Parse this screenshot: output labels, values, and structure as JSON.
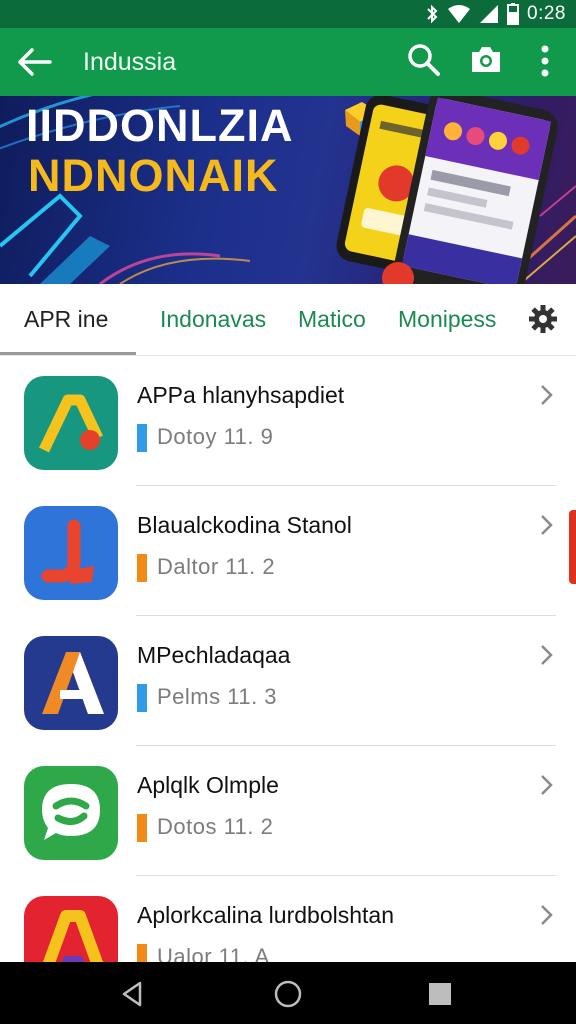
{
  "status_bar": {
    "time": "0:28",
    "icons": [
      "bluetooth-icon",
      "wifi-icon",
      "signal-icon",
      "battery-icon"
    ]
  },
  "app_bar": {
    "title": "Indussia",
    "icons": [
      "back-arrow-icon",
      "search-icon",
      "camera-icon",
      "more-vert-icon"
    ]
  },
  "banner": {
    "line1": "IIDDONLZIA",
    "line2": "NDNONAIK"
  },
  "tabs": [
    {
      "label": "APR  ine",
      "selected": true
    },
    {
      "label": "Indonavas",
      "selected": false
    },
    {
      "label": "Matico",
      "selected": false
    },
    {
      "label": "Monipess",
      "selected": false
    }
  ],
  "apps": [
    {
      "name": "APPa hlanyhsapdiet",
      "meta": "Dotoy  11. 9",
      "marker_color": "#2f9be6",
      "icon": "a-logo-teal-icon"
    },
    {
      "name": "Blaualckodina Stanol",
      "meta": "Daltor  11. 2",
      "marker_color": "#f28a1a",
      "icon": "j-logo-blue-icon"
    },
    {
      "name": "MPechladaqaa",
      "meta": "Pelms  11. 3",
      "marker_color": "#2f9be6",
      "icon": "a-logo-navy-icon"
    },
    {
      "name": "Aplqlk Olmple",
      "meta": "Dotos  11. 2",
      "marker_color": "#f28a1a",
      "icon": "chat-logo-green-icon"
    },
    {
      "name": "Aplorkcalina lurdbolshtan",
      "meta": "Ualor  11. A",
      "marker_color": "#f28a1a",
      "icon": "a-logo-red-icon"
    }
  ],
  "colors": {
    "status_bar": "#0b6b3a",
    "app_bar": "#129a4c",
    "tab_text": "#1a8a52",
    "accent_yellow": "#f6b91c"
  }
}
